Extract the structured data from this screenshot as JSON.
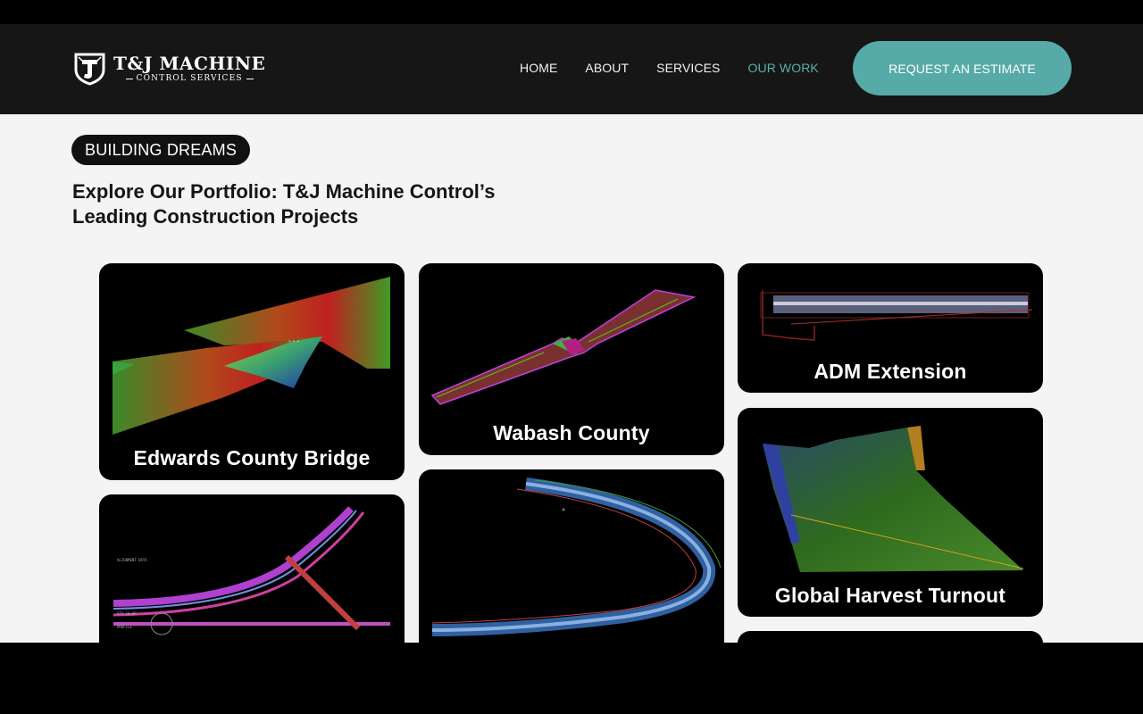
{
  "brand": {
    "name": "T&J MACHINE",
    "tagline": "CONTROL SERVICES"
  },
  "nav": {
    "items": [
      {
        "label": "HOME"
      },
      {
        "label": "ABOUT"
      },
      {
        "label": "SERVICES"
      },
      {
        "label": "OUR WORK",
        "active": true
      }
    ],
    "cta_label": "REQUEST AN ESTIMATE"
  },
  "hero": {
    "badge": "BUILDING DREAMS",
    "headline": "Explore Our Portfolio: T&J Machine Control’s\nLeading Construction Projects"
  },
  "projects": [
    {
      "title": "Edwards County Bridge"
    },
    {
      "title": "Wabash County"
    },
    {
      "title": "ADM Extension"
    },
    {
      "title": "Global Harvest Turnout"
    },
    {
      "title": ""
    },
    {
      "title": ""
    },
    {
      "title": ""
    }
  ],
  "colors": {
    "accent": "#56aaa7",
    "header_bg": "#161616",
    "page_bg": "#f4f4f4",
    "card_bg": "#000000"
  }
}
